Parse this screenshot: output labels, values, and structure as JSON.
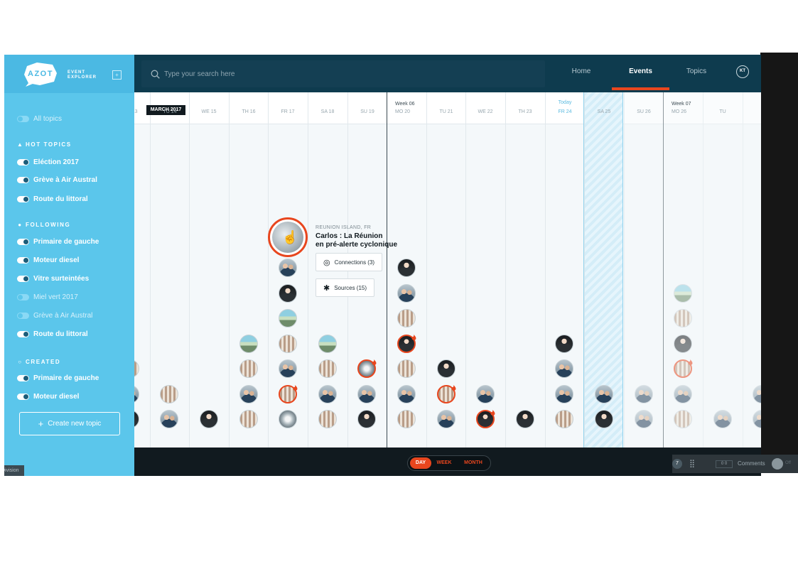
{
  "brand": {
    "logo_text": "AZOT",
    "subtitle_line1": "EVENT",
    "subtitle_line2": "EXPLORER",
    "collapse_symbol": "+"
  },
  "search": {
    "placeholder": "Type your search here"
  },
  "nav": {
    "home": "Home",
    "events": "Events",
    "topics": "Topics",
    "active": "Events",
    "user_initials": "KT"
  },
  "sidebar": {
    "all_topics": {
      "label": "All topics",
      "on": false
    },
    "hot_topics": {
      "heading": "HOT TOPICS",
      "items": [
        {
          "label": "Eléction 2017",
          "on": true
        },
        {
          "label": "Grève à Air Austral",
          "on": true
        },
        {
          "label": "Route du littoral",
          "on": true
        }
      ]
    },
    "following": {
      "heading": "FOLLOWING",
      "items": [
        {
          "label": "Primaire de gauche",
          "on": true
        },
        {
          "label": "Moteur diesel",
          "on": true
        },
        {
          "label": "Vitre surteintées",
          "on": true
        },
        {
          "label": "Miel vert 2017",
          "on": false
        },
        {
          "label": "Grève à Air Austral",
          "on": false
        },
        {
          "label": "Route du littoral",
          "on": true
        }
      ]
    },
    "created": {
      "heading": "CREATED",
      "items": [
        {
          "label": "Primaire de gauche",
          "on": true
        },
        {
          "label": "Moteur diesel",
          "on": true
        }
      ]
    },
    "create_button": "Create new topic",
    "division_tab": "Division"
  },
  "timeline": {
    "month_badge": "MARCH 2017",
    "days": [
      "MO 13",
      "TU 14",
      "WE 15",
      "TH 16",
      "FR 17",
      "SA 18",
      "SU 19",
      "MO 20",
      "TU 21",
      "WE 22",
      "TH 23",
      "FR 24",
      "SA 25",
      "SU 26",
      "MO 26",
      "TU"
    ],
    "week_labels": [
      {
        "label": "Week 06",
        "before_day": 7
      },
      {
        "label": "Week 07",
        "before_day": 14
      }
    ],
    "today_label": "Today",
    "today_index": 11
  },
  "featured_event": {
    "location": "REUNION ISLAND, FR",
    "title_line1": "Carlos : La Réunion",
    "title_line2": "en pré-alerte cyclonique",
    "connections_label": "Connections (3)",
    "sources_label": "Sources (15)"
  },
  "zoom": {
    "options": [
      "DAY",
      "WEEK",
      "MONTH"
    ],
    "active": "DAY"
  },
  "footer": {
    "badge": "7",
    "counter": "0 0",
    "comments_label": "Comments",
    "toggle_state": "Off"
  },
  "colors": {
    "accent": "#e8461e",
    "sidebar": "#5bc6eb",
    "topbar": "#0e3b4e",
    "today": "#5bbbe0"
  },
  "events": [
    {
      "day": 0,
      "row": 0,
      "img": "dark"
    },
    {
      "day": 0,
      "row": 1,
      "img": "people"
    },
    {
      "day": 0,
      "row": 2,
      "img": "crowd"
    },
    {
      "day": 1,
      "row": 0,
      "img": "people"
    },
    {
      "day": 1,
      "row": 1,
      "img": "crowd"
    },
    {
      "day": 2,
      "row": 0,
      "img": "dark"
    },
    {
      "day": 3,
      "row": 0,
      "img": "crowd"
    },
    {
      "day": 3,
      "row": 1,
      "img": "people"
    },
    {
      "day": 3,
      "row": 2,
      "img": "crowd"
    },
    {
      "day": 3,
      "row": 3,
      "img": "street"
    },
    {
      "day": 4,
      "row": 0,
      "img": "storm"
    },
    {
      "day": 4,
      "row": 1,
      "img": "crowd",
      "hot": true
    },
    {
      "day": 4,
      "row": 2,
      "img": "people"
    },
    {
      "day": 4,
      "row": 3,
      "img": "crowd"
    },
    {
      "day": 4,
      "row": 4,
      "img": "street"
    },
    {
      "day": 4,
      "row": 5,
      "img": "dark"
    },
    {
      "day": 4,
      "row": 6,
      "img": "people"
    },
    {
      "day": 5,
      "row": 0,
      "img": "crowd"
    },
    {
      "day": 5,
      "row": 1,
      "img": "people"
    },
    {
      "day": 5,
      "row": 2,
      "img": "crowd"
    },
    {
      "day": 5,
      "row": 3,
      "img": "street"
    },
    {
      "day": 6,
      "row": 0,
      "img": "dark"
    },
    {
      "day": 6,
      "row": 1,
      "img": "people"
    },
    {
      "day": 6,
      "row": 2,
      "img": "storm",
      "hot": true
    },
    {
      "day": 7,
      "row": 0,
      "img": "crowd"
    },
    {
      "day": 7,
      "row": 1,
      "img": "people"
    },
    {
      "day": 7,
      "row": 2,
      "img": "crowd"
    },
    {
      "day": 7,
      "row": 3,
      "img": "dark",
      "hot": true
    },
    {
      "day": 7,
      "row": 4,
      "img": "crowd"
    },
    {
      "day": 7,
      "row": 5,
      "img": "people"
    },
    {
      "day": 7,
      "row": 6,
      "img": "dark"
    },
    {
      "day": 8,
      "row": 0,
      "img": "people"
    },
    {
      "day": 8,
      "row": 1,
      "img": "crowd",
      "hot": true
    },
    {
      "day": 8,
      "row": 2,
      "img": "dark"
    },
    {
      "day": 9,
      "row": 0,
      "img": "dark",
      "hot": true
    },
    {
      "day": 9,
      "row": 1,
      "img": "people"
    },
    {
      "day": 10,
      "row": 0,
      "img": "dark"
    },
    {
      "day": 11,
      "row": 0,
      "img": "crowd"
    },
    {
      "day": 11,
      "row": 1,
      "img": "people"
    },
    {
      "day": 11,
      "row": 2,
      "img": "people"
    },
    {
      "day": 11,
      "row": 3,
      "img": "dark"
    },
    {
      "day": 12,
      "row": 0,
      "img": "dark"
    },
    {
      "day": 12,
      "row": 1,
      "img": "people"
    },
    {
      "day": 13,
      "row": 0,
      "img": "people"
    },
    {
      "day": 13,
      "row": 1,
      "img": "people"
    },
    {
      "day": 14,
      "row": 0,
      "img": "crowd"
    },
    {
      "day": 14,
      "row": 1,
      "img": "people"
    },
    {
      "day": 14,
      "row": 2,
      "img": "crowd",
      "hot": true
    },
    {
      "day": 14,
      "row": 3,
      "img": "dark"
    },
    {
      "day": 14,
      "row": 4,
      "img": "crowd"
    },
    {
      "day": 14,
      "row": 5,
      "img": "street"
    },
    {
      "day": 15,
      "row": 0,
      "img": "people"
    },
    {
      "day": 16,
      "row": 0,
      "img": "people"
    },
    {
      "day": 16,
      "row": 1,
      "img": "people"
    }
  ]
}
